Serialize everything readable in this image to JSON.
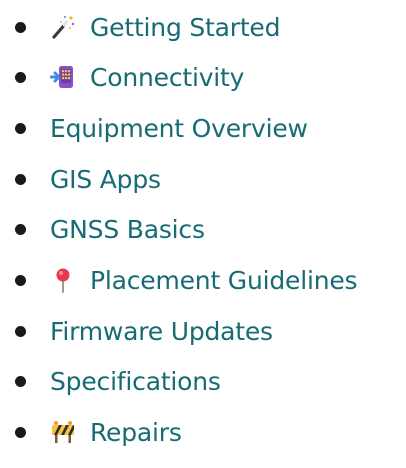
{
  "nav": {
    "items": [
      {
        "label": "Getting Started",
        "icon": "magic-wand-icon"
      },
      {
        "label": "Connectivity",
        "icon": "phone-arrow-icon"
      },
      {
        "label": "Equipment Overview",
        "icon": null
      },
      {
        "label": "GIS Apps",
        "icon": null
      },
      {
        "label": "GNSS Basics",
        "icon": null
      },
      {
        "label": "Placement Guidelines",
        "icon": "round-pushpin-icon"
      },
      {
        "label": "Firmware Updates",
        "icon": null
      },
      {
        "label": "Specifications",
        "icon": null
      },
      {
        "label": "Repairs",
        "icon": "construction-icon"
      }
    ]
  },
  "colors": {
    "link": "#166b74",
    "bullet": "#1a1a1a"
  }
}
